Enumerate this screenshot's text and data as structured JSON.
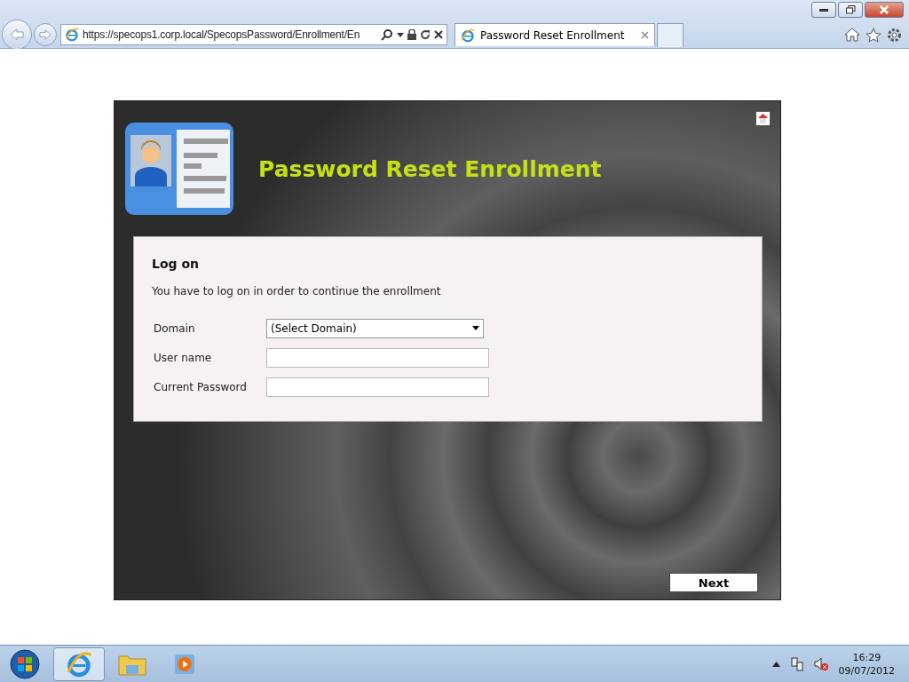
{
  "browser": {
    "url": "https://specops1.corp.local/SpecopsPassword/Enrollment/En",
    "tabs": [
      {
        "title": "Password Reset Enrollment",
        "selected": true
      }
    ]
  },
  "page": {
    "title": "Password Reset Enrollment",
    "form": {
      "heading": "Log on",
      "intro": "You have to log on in order to continue the enrollment",
      "fields": [
        {
          "kind": "select",
          "label": "Domain",
          "value": "(Select Domain)"
        },
        {
          "kind": "text",
          "label": "User name"
        },
        {
          "kind": "password",
          "label": "Current Password"
        }
      ]
    },
    "next_button": "Next"
  },
  "taskbar": {
    "time": "16:29",
    "date": "09/07/2012"
  }
}
